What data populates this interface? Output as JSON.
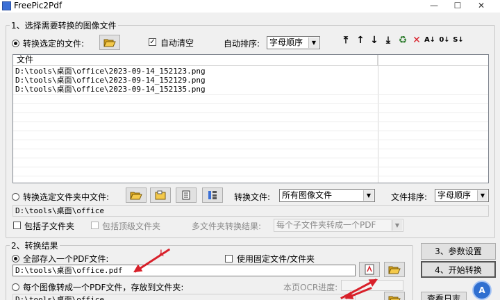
{
  "window": {
    "title": "FreePic2Pdf"
  },
  "section1": {
    "legend": "1、选择需要转换的图像文件",
    "radio_files_label": "转换选定的文件:",
    "auto_clear_label": "自动清空",
    "auto_sort_label": "自动排序:",
    "auto_sort_value": "字母顺序",
    "list_header": "文件",
    "files": [
      "D:\\tools\\桌面\\office\\2023-09-14_152123.png",
      "D:\\tools\\桌面\\office\\2023-09-14_152129.png",
      "D:\\tools\\桌面\\office\\2023-09-14_152135.png"
    ],
    "radio_folder_label": "转换选定文件夹中文件:",
    "convert_files_label": "转换文件:",
    "convert_files_value": "所有图像文件",
    "file_sort_label": "文件排序:",
    "file_sort_value": "字母顺序",
    "folder_path": "D:\\tools\\桌面\\office",
    "include_subfolders_label": "包括子文件夹",
    "include_top_folder_label": "包括顶级文件夹",
    "multi_folder_label": "多文件夹转换结果:",
    "multi_folder_value": "每个子文件夹转成一个PDF"
  },
  "section2": {
    "legend": "2、转换结果",
    "save_all_label": "全部存入一个PDF文件:",
    "fixed_file_label": "使用固定文件/文件夹",
    "output_pdf_path": "D:\\tools\\桌面\\office.pdf",
    "each_image_label": "每个图像转成一个PDF文件，存放到文件夹:",
    "ocr_progress_label": "本页OCR进度:",
    "output_folder_path": "D:\\tools\\桌面\\office"
  },
  "buttons": {
    "params": "3、参数设置",
    "start": "4、开始转换",
    "view_log": "查看日志"
  },
  "colors": {
    "accent_red": "#d8202a",
    "list_bg": "#ffffff",
    "window_bg": "#f0f0f0"
  }
}
